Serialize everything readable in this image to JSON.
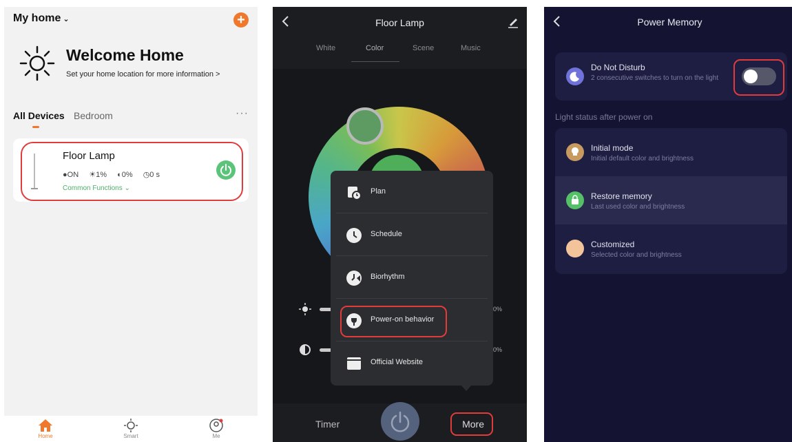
{
  "home": {
    "home_name": "My home",
    "welcome_title": "Welcome Home",
    "welcome_sub": "Set your home location for more information  >",
    "tabs": [
      "All Devices",
      "Bedroom"
    ],
    "more": "···",
    "device": {
      "name": "Floor Lamp",
      "status": [
        "ON",
        "1%",
        "0%",
        "0 s"
      ],
      "common_functions": "Common Functions"
    },
    "nav": [
      "Home",
      "Smart",
      "Me"
    ],
    "accent_color": "#f0782d"
  },
  "lamp": {
    "title": "Floor Lamp",
    "tabs": [
      "White",
      "Color",
      "Scene",
      "Music"
    ],
    "slider_values": [
      "0%",
      "0%"
    ],
    "menu": [
      "Plan",
      "Schedule",
      "Biorhythm",
      "Power-on behavior",
      "Official Website"
    ],
    "footer": {
      "timer": "Timer",
      "more": "More"
    }
  },
  "memory": {
    "title": "Power Memory",
    "dnd": {
      "title": "Do Not Disturb",
      "sub": "2 consecutive switches to turn on the light",
      "enabled": false
    },
    "section": "Light status after power on",
    "options": [
      {
        "title": "Initial mode",
        "sub": "Initial default color and brightness"
      },
      {
        "title": "Restore memory",
        "sub": "Last used color and brightness"
      },
      {
        "title": "Customized",
        "sub": "Selected color and brightness"
      }
    ]
  }
}
